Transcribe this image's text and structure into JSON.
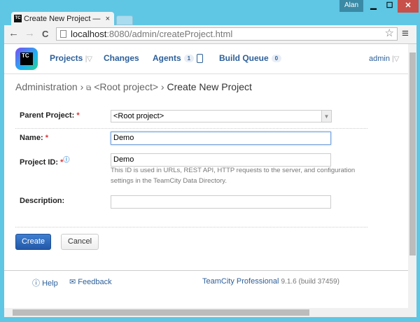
{
  "window": {
    "user": "Alan",
    "minimize": "▁",
    "maximize": "☐",
    "close": "✕"
  },
  "tab": {
    "favicon": "TC",
    "title": "Create New Project — Tea",
    "close": "×"
  },
  "toolbar": {
    "back": "←",
    "forward": "→",
    "reload": "C",
    "url_host": "localhost",
    "url_rest": ":8080/admin/createProject.html",
    "star": "☆",
    "menu": "≡"
  },
  "header": {
    "logo": "TC",
    "nav": [
      {
        "label": "Projects"
      },
      {
        "label": "Changes"
      },
      {
        "label": "Agents",
        "count": "1"
      },
      {
        "label": "Build Queue",
        "count": "0"
      }
    ],
    "user": "admin"
  },
  "breadcrumb": {
    "items": [
      "Administration",
      "<Root project>",
      "Create New Project"
    ]
  },
  "form": {
    "parent": {
      "label": "Parent Project:",
      "value": "<Root project>"
    },
    "name": {
      "label": "Name:",
      "value": "Demo"
    },
    "project_id": {
      "label": "Project ID:",
      "value": "Demo",
      "help_line1": "This ID is used in URLs, REST API, HTTP requests to the server, and configuration",
      "help_line2": "settings in the TeamCity Data Directory."
    },
    "description": {
      "label": "Description:",
      "value": ""
    },
    "required_mark": "*",
    "create": "Create",
    "cancel": "Cancel"
  },
  "footer": {
    "help": "Help",
    "feedback": "Feedback",
    "product": "TeamCity Professional",
    "version": "9.1.6 (build 37459)"
  },
  "colors": {
    "frame": "#5fc6e4",
    "link": "#2c5f99",
    "primary_button": "#2a64b8"
  }
}
